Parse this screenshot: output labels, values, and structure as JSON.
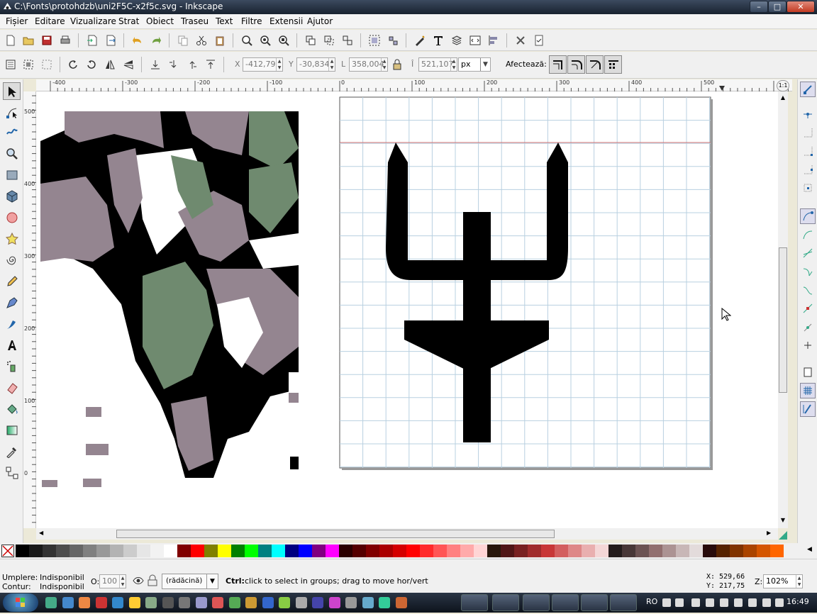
{
  "window": {
    "title": "C:\\Fonts\\protohdzb\\uni2F5C-x2f5c.svg - Inkscape",
    "btn_min": "–",
    "btn_max": "□",
    "btn_close": "✕"
  },
  "menu": [
    "Fișier",
    "Editare",
    "Vizualizare",
    "Strat",
    "Obiect",
    "Traseu",
    "Text",
    "Filtre",
    "Extensii",
    "Ajutor"
  ],
  "select_toolbar": {
    "x_label": "X",
    "x_value": "-412,79",
    "y_label": "Y",
    "y_value": "-30,834",
    "w_label": "L",
    "w_value": "358,004",
    "h_label": "Î",
    "h_value": "521,107",
    "unit": "px",
    "affect_label": "Afectează:"
  },
  "ruler": {
    "h_labels": [
      "-400",
      "-300",
      "-200",
      "-100",
      "0",
      "100",
      "200",
      "300",
      "400",
      "500"
    ],
    "v_labels": [
      "0",
      "100",
      "200",
      "300",
      "400",
      "500"
    ]
  },
  "palette_colors": [
    "#000000",
    "#1a1a1a",
    "#333333",
    "#4d4d4d",
    "#666666",
    "#808080",
    "#999999",
    "#b3b3b3",
    "#cccccc",
    "#e6e6e6",
    "#f2f2f2",
    "#ffffff",
    "#800000",
    "#ff0000",
    "#808000",
    "#ffff00",
    "#008000",
    "#00ff00",
    "#008080",
    "#00ffff",
    "#000080",
    "#0000ff",
    "#800080",
    "#ff00ff",
    "#2b0000",
    "#550000",
    "#800000",
    "#aa0000",
    "#d40000",
    "#ff0000",
    "#ff2a2a",
    "#ff5555",
    "#ff8080",
    "#ffaaaa",
    "#ffd5d5",
    "#28170b",
    "#501616",
    "#782121",
    "#a02c2c",
    "#c83737",
    "#d35f5f",
    "#de8787",
    "#e9afaf",
    "#f4d7d7",
    "#241c1c",
    "#483737",
    "#6c5353",
    "#916f6f",
    "#ac9393",
    "#c8b7b7",
    "#e3dbdb",
    "#280b0b",
    "#552200",
    "#803300",
    "#aa4400",
    "#d45500",
    "#ff6600"
  ],
  "status": {
    "fill_label": "Umplere:",
    "fill_value": "Indisponibil",
    "stroke_label": "Contur:",
    "stroke_value": "Indisponibil",
    "opacity_label": "O:",
    "opacity_value": "100",
    "layer": "(rădăcină)",
    "message_bold": "Ctrl:",
    "message": " click to select in groups; drag to move hor/vert",
    "x_label": "X:",
    "x_value": "529,66",
    "y_label": "Y:",
    "y_value": "217,75",
    "zoom_label": "Z:",
    "zoom_value": "102%"
  },
  "taskbar": {
    "lang": "RO",
    "clock": "16:49"
  }
}
